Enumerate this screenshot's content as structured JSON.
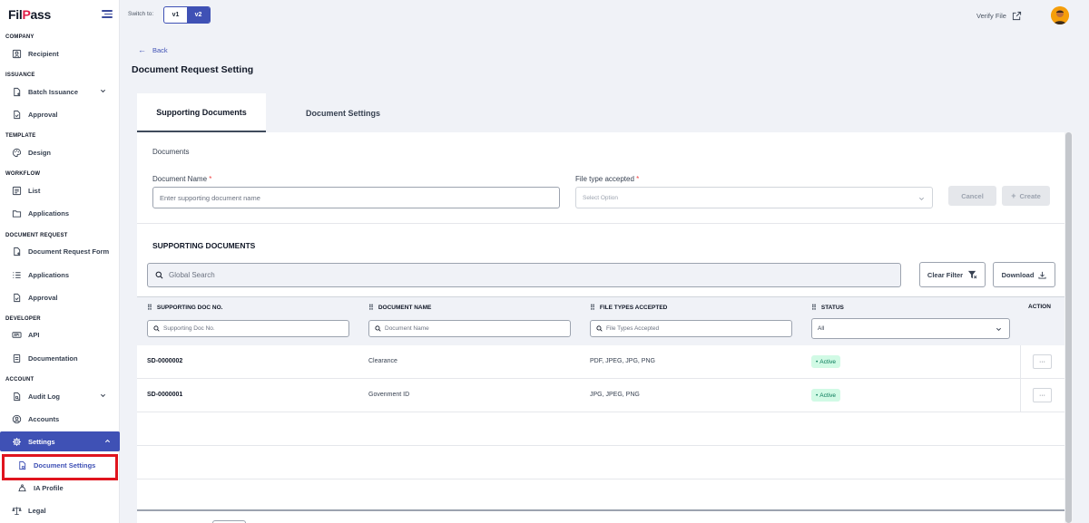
{
  "brand": {
    "logo_pre": "Fil",
    "logo_mark": "P",
    "logo_post": "ass"
  },
  "sidebar": {
    "sections": {
      "company": "COMPANY",
      "issuance": "ISSUANCE",
      "template": "TEMPLATE",
      "workflow": "WORKFLOW",
      "document_request": "DOCUMENT REQUEST",
      "developer": "DEVELOPER",
      "account": "ACCOUNT"
    },
    "items": {
      "recipient": "Recipient",
      "batch_issuance": "Batch Issuance",
      "approval_issuance": "Approval",
      "design": "Design",
      "list": "List",
      "applications_workflow": "Applications",
      "document_request_form": "Document Request Form",
      "applications_request": "Applications",
      "approval_request": "Approval",
      "api": "API",
      "documentation": "Documentation",
      "audit_log": "Audit Log",
      "accounts": "Accounts",
      "settings": "Settings",
      "document_settings": "Document Settings",
      "ia_profile": "IA Profile",
      "legal": "Legal"
    }
  },
  "topbar": {
    "switch_label": "Switch to:",
    "v1": "v1",
    "v2": "v2",
    "verify_file": "Verify File"
  },
  "page": {
    "back": "Back",
    "title": "Document Request Setting"
  },
  "tabs": {
    "supporting_documents": "Supporting Documents",
    "document_settings": "Document Settings"
  },
  "form": {
    "section_title": "Documents",
    "document_name_label": "Document Name",
    "document_name_placeholder": "Enter supporting document name",
    "file_type_label": "File type accepted",
    "file_type_placeholder": "Select Option",
    "required_mark": "*",
    "cancel": "Cancel",
    "create": "Create"
  },
  "list": {
    "title": "SUPPORTING DOCUMENTS",
    "global_search_placeholder": "Global Search",
    "clear_filter": "Clear Filter",
    "download": "Download",
    "columns": {
      "doc_no": "SUPPORTING DOC NO.",
      "doc_name": "DOCUMENT NAME",
      "file_types": "FILE TYPES ACCEPTED",
      "status": "STATUS",
      "action": "ACTION"
    },
    "filters": {
      "doc_no": "Supporting Doc No.",
      "doc_name": "Document Name",
      "file_types": "File Types Accepted",
      "status": "All"
    },
    "rows": [
      {
        "doc_no": "SD-0000002",
        "name": "Clearance",
        "types": "PDF, JPEG, JPG, PNG",
        "status": "Active",
        "action": "···"
      },
      {
        "doc_no": "SD-0000001",
        "name": "Govenment ID",
        "types": "JPG, JPEG, PNG",
        "status": "Active",
        "action": "···"
      }
    ]
  },
  "colors": {
    "primary": "#3f51b5",
    "highlight": "#e0141e",
    "active_badge_bg": "#d1fae5",
    "active_badge_text": "#047857"
  }
}
